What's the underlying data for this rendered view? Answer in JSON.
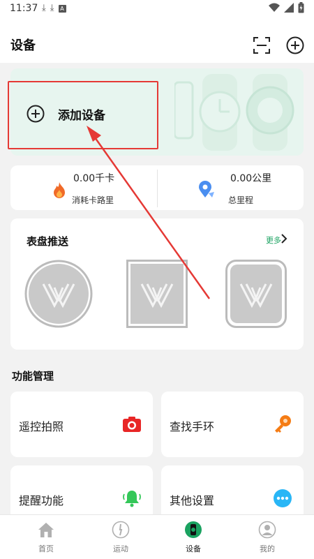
{
  "status_bar": {
    "time": "11:37",
    "icons": [
      "download-icon",
      "download-icon",
      "a-icon",
      "wifi-icon",
      "signal-icon",
      "battery-icon"
    ]
  },
  "header": {
    "title": "设备",
    "actions": [
      "scan-icon",
      "add-icon"
    ]
  },
  "banner": {
    "add_label": "添加设备",
    "icon": "add-circle-icon"
  },
  "stats": {
    "calories": {
      "value": "0.00千卡",
      "label": "消耗卡路里",
      "icon": "flame-icon"
    },
    "distance": {
      "value": "0.00公里",
      "label": "总里程",
      "icon": "location-icon"
    }
  },
  "dial_push": {
    "title": "表盘推送",
    "more_label": "更多",
    "dials": [
      "round-dial",
      "square-dial",
      "rounded-square-dial"
    ]
  },
  "function_section": {
    "title": "功能管理"
  },
  "functions": [
    {
      "label": "遥控拍照",
      "icon": "camera-icon"
    },
    {
      "label": "查找手环",
      "icon": "key-icon"
    },
    {
      "label": "提醒功能",
      "icon": "bell-icon"
    },
    {
      "label": "其他设置",
      "icon": "more-icon"
    }
  ],
  "nav": [
    {
      "label": "首页",
      "icon": "home-icon"
    },
    {
      "label": "运动",
      "icon": "run-icon"
    },
    {
      "label": "设备",
      "icon": "watch-icon",
      "active": true
    },
    {
      "label": "我的",
      "icon": "profile-icon"
    }
  ],
  "colors": {
    "accent": "#1aa260",
    "highlight": "#e53935",
    "banner_bg": "#e7f5ef"
  }
}
